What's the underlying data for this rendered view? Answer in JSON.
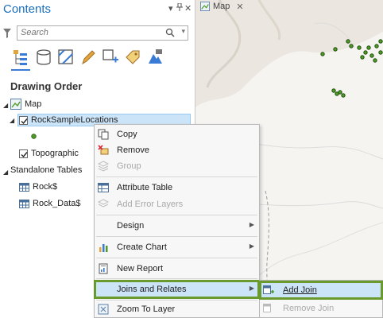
{
  "contents": {
    "title": "Contents",
    "header_buttons": [
      "▾",
      "🖈",
      "✕"
    ],
    "search": {
      "placeholder": "Search"
    },
    "section_title": "Drawing Order",
    "tree": {
      "map": "Map",
      "layer_selected": "RockSampleLocations",
      "layer2": "Topographic",
      "standalone_header": "Standalone Tables",
      "table1": "Rock$",
      "table2": "Rock_Data$"
    }
  },
  "map_tab": {
    "label": "Map",
    "close": "✕"
  },
  "context_menu": {
    "items": {
      "copy": "Copy",
      "remove": "Remove",
      "group": "Group",
      "attribute_table": "Attribute Table",
      "add_error_layers": "Add Error Layers",
      "design": "Design",
      "create_chart": "Create Chart",
      "new_report": "New Report",
      "joins_relates": "Joins and Relates",
      "zoom_to_layer": "Zoom To Layer"
    },
    "submenu": {
      "add_join": "Add Join",
      "remove_join": "Remove Join"
    }
  },
  "colors": {
    "title_blue": "#1b6fbd",
    "selection": "#cce4f7",
    "highlight_border": "#6a9a2d",
    "point_green": "#4f9a2a"
  }
}
